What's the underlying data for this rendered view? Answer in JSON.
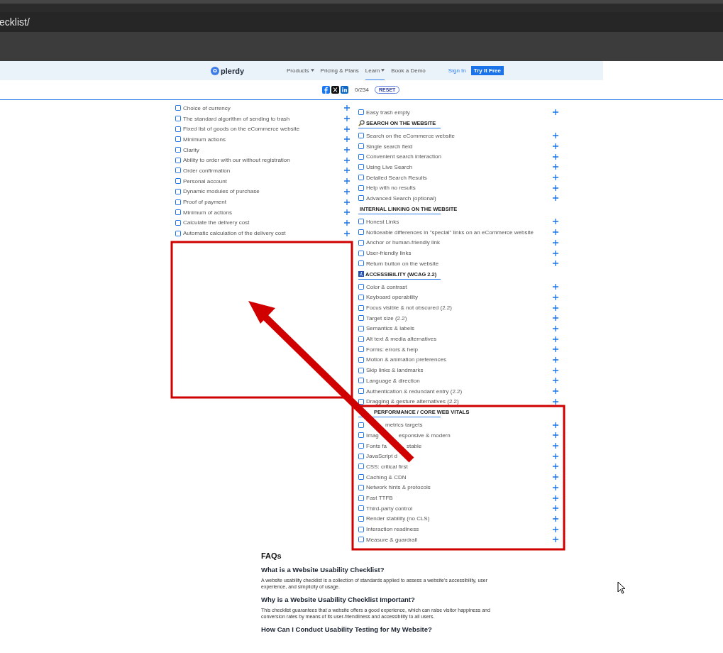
{
  "browser": {
    "url": "ecklist/"
  },
  "nav": {
    "logo": "plerdy",
    "links": [
      {
        "label": "Products",
        "has_menu": true,
        "selected": false
      },
      {
        "label": "Pricing & Plans",
        "has_menu": false,
        "selected": false
      },
      {
        "label": "Learn",
        "has_menu": true,
        "selected": true
      },
      {
        "label": "Book a Demo",
        "has_menu": false,
        "selected": false
      }
    ],
    "sign_in": "Sign In",
    "cta": "Try It Free"
  },
  "share": {
    "progress": "0/234",
    "reset": "RESET"
  },
  "left_items": [
    {
      "text": "Choice of currency",
      "checked": false
    },
    {
      "text": "The standard algorithm of sending to trash",
      "checked": false
    },
    {
      "text": "Fixed list of goods on the eCommerce website",
      "checked": false
    },
    {
      "text": "Minimum actions",
      "checked": false
    },
    {
      "text": "Clarity",
      "checked": false
    },
    {
      "text": "Ability to order with our without registration",
      "checked": false
    },
    {
      "text": "Order confirmation",
      "checked": false
    },
    {
      "text": "Personal account",
      "checked": false
    },
    {
      "text": "Dynamic modules of purchase",
      "checked": false
    },
    {
      "text": "Proof of payment",
      "checked": false
    },
    {
      "text": "Minimum of actions",
      "checked": false
    },
    {
      "text": "Calculate the delivery cost",
      "checked": false
    },
    {
      "text": "Automatic calculation of the delivery cost",
      "checked": false
    }
  ],
  "right_items": [
    {
      "kind": "item",
      "text": "Easy trash empty",
      "checked": false
    },
    {
      "kind": "heading",
      "text": "SEARCH ON THE WEBSITE"
    },
    {
      "kind": "item",
      "text": "Search on the eCommerce website",
      "checked": false
    },
    {
      "kind": "item",
      "text": "Single search field",
      "checked": false
    },
    {
      "kind": "item",
      "text": "Convenient search interaction",
      "checked": false
    },
    {
      "kind": "item",
      "text": "Using Live Search",
      "checked": false
    },
    {
      "kind": "item",
      "text": "Detailed Search Results",
      "checked": false
    },
    {
      "kind": "item",
      "text": "Help with no results",
      "checked": false
    },
    {
      "kind": "item",
      "text": "Advanced Search (optional)",
      "checked": false
    },
    {
      "kind": "heading",
      "text": "INTERNAL LINKING ON THE WEBSITE"
    },
    {
      "kind": "item",
      "text": "Honest Links",
      "checked": false
    },
    {
      "kind": "item",
      "text": "Noticeable differences in \"special\" links on an eCommerce website",
      "checked": false
    },
    {
      "kind": "item",
      "text": "Anchor or human-friendly link",
      "checked": false
    },
    {
      "kind": "item",
      "text": "User-friendly links",
      "checked": false
    },
    {
      "kind": "item",
      "text": "Return button on the website",
      "checked": false
    },
    {
      "kind": "heading",
      "text": "ACCESSIBILITY (WCAG 2.2)"
    },
    {
      "kind": "item",
      "text": "Color & contrast",
      "checked": false
    },
    {
      "kind": "item",
      "text": "Keyboard operability",
      "checked": false
    },
    {
      "kind": "item",
      "text": "Focus visible & not obscured (2.2)",
      "checked": false
    },
    {
      "kind": "item",
      "text": "Target size (2.2)",
      "checked": false
    },
    {
      "kind": "item",
      "text": "Semantics & labels",
      "checked": false
    },
    {
      "kind": "item",
      "text": "Alt text & media alternatives",
      "checked": false
    },
    {
      "kind": "item",
      "text": "Forms: errors & help",
      "checked": false
    },
    {
      "kind": "item",
      "text": "Motion & animation preferences",
      "checked": false
    },
    {
      "kind": "item",
      "text": "Skip links & landmarks",
      "checked": false
    },
    {
      "kind": "item",
      "text": "Language & direction",
      "checked": false
    },
    {
      "kind": "item",
      "text": "Authentication & redundant entry (2.2)",
      "checked": false
    },
    {
      "kind": "item",
      "text": "Dragging & gesture alternatives (2.2)",
      "checked": false
    },
    {
      "kind": "heading",
      "text": "PERFORMANCE / CORE WEB VITALS"
    },
    {
      "kind": "covered",
      "parts": [
        "metrics targets"
      ],
      "leading_hidden": true,
      "checked": false
    },
    {
      "kind": "covered",
      "parts": [
        "Imag",
        "esponsive & modern"
      ],
      "leading_hidden": false,
      "checked": false
    },
    {
      "kind": "covered",
      "parts": [
        "Fonts fa",
        "stable"
      ],
      "leading_hidden": false,
      "checked": false
    },
    {
      "kind": "covered",
      "parts": [
        "JavaScript d"
      ],
      "leading_hidden": false,
      "checked": false
    },
    {
      "kind": "item",
      "text": "CSS: critical first",
      "checked": false
    },
    {
      "kind": "item",
      "text": "Caching & CDN",
      "checked": false
    },
    {
      "kind": "item",
      "text": "Network hints & protocols",
      "checked": false
    },
    {
      "kind": "item",
      "text": "Fast TTFB",
      "checked": false
    },
    {
      "kind": "item",
      "text": "Third-party control",
      "checked": false
    },
    {
      "kind": "item",
      "text": "Render stability (no CLS)",
      "checked": false
    },
    {
      "kind": "item",
      "text": "Interaction readiness",
      "checked": false
    },
    {
      "kind": "item",
      "text": "Measure & guardrail",
      "checked": false
    }
  ],
  "faq": {
    "title": "FAQs",
    "entries": [
      {
        "question": "What is a Website Usability Checklist?",
        "answer": "A website usability checklist is a collection of standards applied to assess a website's accessibility, user experience, and simplicity of usage."
      },
      {
        "question": "Why is a Website Usability Checklist Important?",
        "answer": "This checklist guarantees that a website offers a good experience, which can raise visitor happiness and conversion rates by means of its user-friendliness and accessibility to all users."
      },
      {
        "question": "How Can I Conduct Usability Testing for My Website?"
      }
    ]
  }
}
